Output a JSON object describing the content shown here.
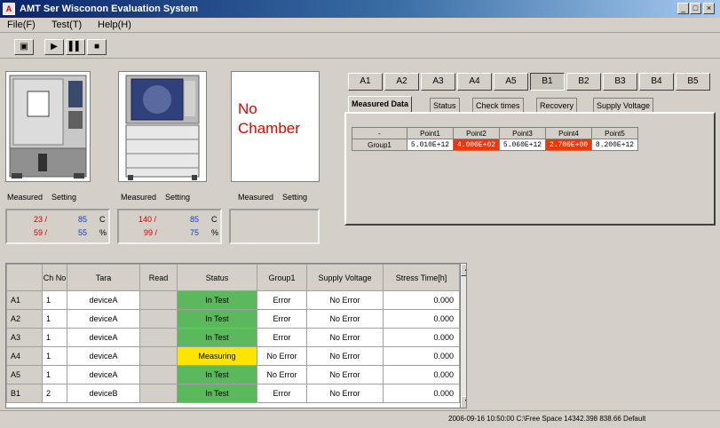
{
  "window": {
    "title": "AMT Ser Wisconon Evaluation System"
  },
  "menu": [
    "File(F)",
    "Test(T)",
    "Help(H)"
  ],
  "toolbar": {
    "buttons": [
      {
        "icon": "save-icon",
        "glyph": "▣"
      },
      {
        "icon": "play-icon",
        "glyph": "▶"
      },
      {
        "icon": "pause-icon",
        "glyph": "▌▌"
      },
      {
        "icon": "stop-icon",
        "glyph": "■"
      }
    ]
  },
  "chambers": [
    {
      "measured_label": "Measured",
      "setting_label": "Setting",
      "temp_measured": "23 /",
      "temp_setting": "85",
      "temp_unit": "C",
      "hum_measured": "59 /",
      "hum_setting": "55",
      "hum_unit": "%"
    },
    {
      "measured_label": "Measured",
      "setting_label": "Setting",
      "temp_measured": "140 /",
      "temp_setting": "85",
      "temp_unit": "C",
      "hum_measured": "99 /",
      "hum_setting": "75",
      "hum_unit": "%"
    },
    {
      "measured_label": "Measured",
      "setting_label": "Setting",
      "no_chamber": "No\nChamber"
    }
  ],
  "board_tabs": {
    "items": [
      "A1",
      "A2",
      "A3",
      "A4",
      "A5",
      "B1",
      "B2",
      "B3",
      "B4",
      "B5"
    ],
    "active": 5
  },
  "sub_tabs": {
    "items": [
      "Measured Data",
      "Status",
      "Check times",
      "Recovery",
      "Supply Voltage"
    ],
    "active": 0
  },
  "measured_table": {
    "corner": "-",
    "points": [
      "Point1",
      "Point2",
      "Point3",
      "Point4",
      "Point5"
    ],
    "rows": [
      {
        "label": "Group1",
        "values": [
          "5.010E+12",
          "4.000E+02",
          "5.060E+12",
          "2.700E+00",
          "8.200E+12"
        ],
        "errors": [
          false,
          true,
          false,
          true,
          false
        ]
      }
    ]
  },
  "main_grid": {
    "headers": [
      "",
      "Ch No",
      "Tara",
      "Read",
      "Status",
      "Group1",
      "Supply Voltage",
      "Stress Time[h]"
    ],
    "rows": [
      {
        "id": "A1",
        "ch": "1",
        "name": "deviceA",
        "read": "",
        "status": "In Test",
        "status_color": "green",
        "group1": "Error",
        "voltage": "No Error",
        "time": "0.000"
      },
      {
        "id": "A2",
        "ch": "1",
        "name": "deviceA",
        "read": "",
        "status": "In Test",
        "status_color": "green",
        "group1": "Error",
        "voltage": "No Error",
        "time": "0.000"
      },
      {
        "id": "A3",
        "ch": "1",
        "name": "deviceA",
        "read": "",
        "status": "In Test",
        "status_color": "green",
        "group1": "Error",
        "voltage": "No Error",
        "time": "0.000"
      },
      {
        "id": "A4",
        "ch": "1",
        "name": "deviceA",
        "read": "",
        "status": "Measuring",
        "status_color": "yellow",
        "group1": "No Error",
        "voltage": "No Error",
        "time": "0.000"
      },
      {
        "id": "A5",
        "ch": "1",
        "name": "deviceA",
        "read": "",
        "status": "In Test",
        "status_color": "green",
        "group1": "No Error",
        "voltage": "No Error",
        "time": "0.000"
      },
      {
        "id": "B1",
        "ch": "2",
        "name": "deviceB",
        "read": "",
        "status": "In Test",
        "status_color": "green",
        "group1": "Error",
        "voltage": "No Error",
        "time": "0.000"
      }
    ]
  },
  "status_bar": {
    "text": "2006-09-16 10:50:00   C:\\Free Space 14342.398 838.66 Default"
  },
  "colors": {
    "title_start": "#0a246a",
    "error_red": "#ff3300",
    "ok_green": "#5cb85c",
    "measuring_yellow": "#ffe400",
    "chamber_label_red": "#e00000"
  }
}
